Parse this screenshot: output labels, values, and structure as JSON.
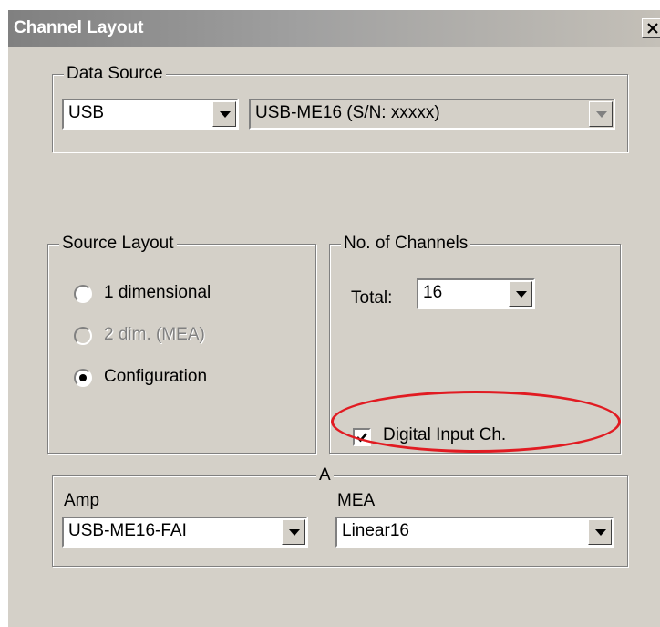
{
  "window": {
    "title": "Channel Layout",
    "close_glyph": "X"
  },
  "data_source": {
    "legend": "Data Source",
    "interface": "USB",
    "device": "USB-ME16   (S/N: xxxxx)"
  },
  "source_layout": {
    "legend": "Source Layout",
    "options": [
      {
        "label": "1 dimensional",
        "selected": false,
        "enabled": true
      },
      {
        "label": "2 dim. (MEA)",
        "selected": false,
        "enabled": false
      },
      {
        "label": "Configuration",
        "selected": true,
        "enabled": true
      }
    ]
  },
  "channels": {
    "legend": "No. of Channels",
    "total_label": "Total:",
    "total_value": "16",
    "digital_input_label": "Digital Input Ch.",
    "digital_input_checked": true
  },
  "bottom": {
    "legend": "A",
    "amp_label": "Amp",
    "amp_value": "USB-ME16-FAI",
    "mea_label": "MEA",
    "mea_value": "Linear16"
  },
  "colors": {
    "dialog_bg": "#d4d0c8",
    "highlight": "#e11b22"
  }
}
